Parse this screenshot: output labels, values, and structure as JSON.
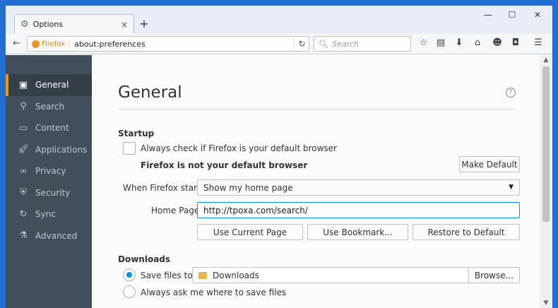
{
  "window": {
    "tab_title": "Options",
    "tab_close": "×",
    "new_tab": "+",
    "minimize": "—",
    "maximize": "☐",
    "close": "✕"
  },
  "navbar": {
    "back": "←",
    "identity_label": "Firefox",
    "url": "about:preferences",
    "reload": "↻",
    "search_placeholder": "Search",
    "icons": [
      "bookmark-star-icon",
      "library-icon",
      "download-icon",
      "home-icon",
      "chat-icon",
      "pocket-icon",
      "menu-icon"
    ]
  },
  "sidebar": {
    "items": [
      {
        "label": "General",
        "icon": "general-icon",
        "active": true
      },
      {
        "label": "Search",
        "icon": "search-icon",
        "active": false
      },
      {
        "label": "Content",
        "icon": "content-icon",
        "active": false
      },
      {
        "label": "Applications",
        "icon": "applications-icon",
        "active": false
      },
      {
        "label": "Privacy",
        "icon": "privacy-mask-icon",
        "active": false
      },
      {
        "label": "Security",
        "icon": "security-icon",
        "active": false
      },
      {
        "label": "Sync",
        "icon": "sync-icon",
        "active": false
      },
      {
        "label": "Advanced",
        "icon": "advanced-icon",
        "active": false
      }
    ]
  },
  "main": {
    "title": "General",
    "help": "?",
    "startup": {
      "section_title": "Startup",
      "default_check_label": "Always check if Firefox is your default browser",
      "default_check_checked": false,
      "not_default_text": "Firefox is not your default browser",
      "make_default_button": "Make Default",
      "when_starts_label": "When Firefox starts:",
      "when_starts_value": "Show my home page",
      "home_page_label": "Home Page:",
      "home_page_value": "http://tpoxa.com/search/",
      "use_current_button": "Use Current Page",
      "use_bookmark_button": "Use Bookmark...",
      "restore_default_button": "Restore to Default"
    },
    "downloads": {
      "section_title": "Downloads",
      "save_files_label": "Save files to",
      "save_files_selected": true,
      "folder_name": "Downloads",
      "browse_button": "Browse...",
      "always_ask_label": "Always ask me where to save files",
      "always_ask_selected": false
    }
  },
  "colors": {
    "sidebar_bg": "#424f5a",
    "sidebar_active_bg": "#343f48",
    "active_accent": "#ff9500",
    "focus_blue": "#0095dd",
    "window_frame": "#1e6fd0"
  }
}
